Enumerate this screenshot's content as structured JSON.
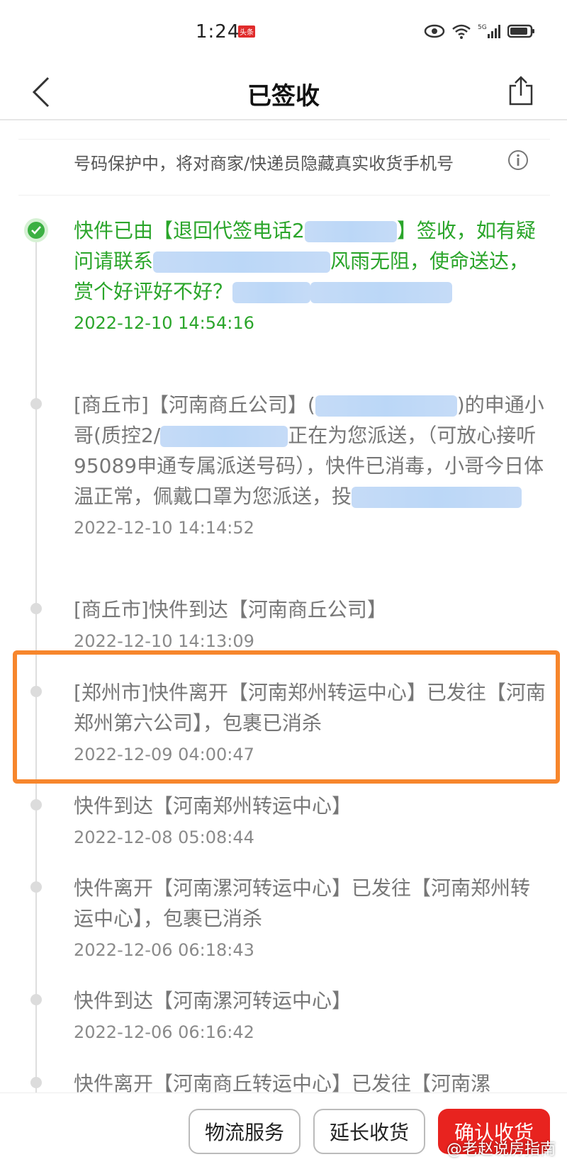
{
  "status_bar": {
    "time": "1:24",
    "badge": "头条"
  },
  "nav": {
    "title": "已签收"
  },
  "privacy": {
    "text": "号码保护中，将对商家/快递员隐藏真实收货手机号"
  },
  "events": [
    {
      "text_parts": [
        "快件已由【退回代签电话2",
        "】签收，如有疑问请联系",
        "风雨无阻，使命送达，赏个好评好不好？"
      ],
      "time": "2022-12-10 14:54:16"
    },
    {
      "text_parts": [
        "[商丘市]【河南商丘公司】(",
        ")的申通小哥(质控2/",
        "正在为您派送，（可放心接听95089申通专属派送号码），快件已消毒，小哥今日体温正常，佩戴口罩为您派送，投",
        ""
      ],
      "time": "2022-12-10 14:14:52"
    },
    {
      "text": "[商丘市]快件到达【河南商丘公司】",
      "time": "2022-12-10 14:13:09"
    },
    {
      "text": "[郑州市]快件离开【河南郑州转运中心】已发往【河南郑州第六公司】，包裹已消杀",
      "time": "2022-12-09 04:00:47"
    },
    {
      "text": "快件到达【河南郑州转运中心】",
      "time": "2022-12-08 05:08:44"
    },
    {
      "text": "快件离开【河南漯河转运中心】已发往【河南郑州转运中心】，包裹已消杀",
      "time": "2022-12-06 06:18:43"
    },
    {
      "text": "快件到达【河南漯河转运中心】",
      "time": "2022-12-06 06:16:42"
    },
    {
      "text": "快件离开【河南商丘转运中心】已发往【河南漯"
    }
  ],
  "buttons": {
    "logistics": "物流服务",
    "extend": "延长收货",
    "confirm": "确认收货"
  },
  "watermark": "@老赵说房指南",
  "colors": {
    "accent_green": "#2aa52a",
    "primary_red": "#e8231f",
    "highlight_orange": "#f7862c"
  }
}
